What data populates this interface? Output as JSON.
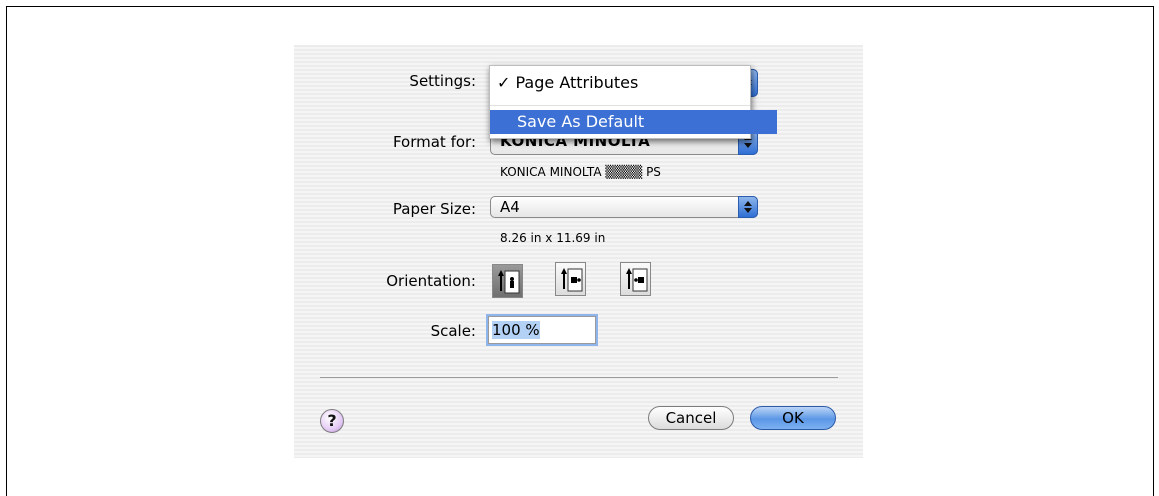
{
  "settings": {
    "label": "Settings:",
    "menu": {
      "checked_item": "Page Attributes",
      "highlighted_item": "Save As Default"
    }
  },
  "format_for": {
    "label": "Format for:",
    "value": "KONICA MINOLTA",
    "printer_desc": "KONICA MINOLTA ▒▒▒▒ PS"
  },
  "paper_size": {
    "label": "Paper Size:",
    "value": "A4",
    "dimensions": "8.26 in x 11.69 in"
  },
  "orientation": {
    "label": "Orientation:",
    "options": [
      "portrait",
      "landscape-left",
      "landscape-right"
    ],
    "selected": "portrait"
  },
  "scale": {
    "label": "Scale:",
    "value": "100 %"
  },
  "buttons": {
    "help": "?",
    "cancel": "Cancel",
    "ok": "OK"
  },
  "colors": {
    "highlight": "#3d70d4",
    "default_button": "#5b97e6"
  }
}
